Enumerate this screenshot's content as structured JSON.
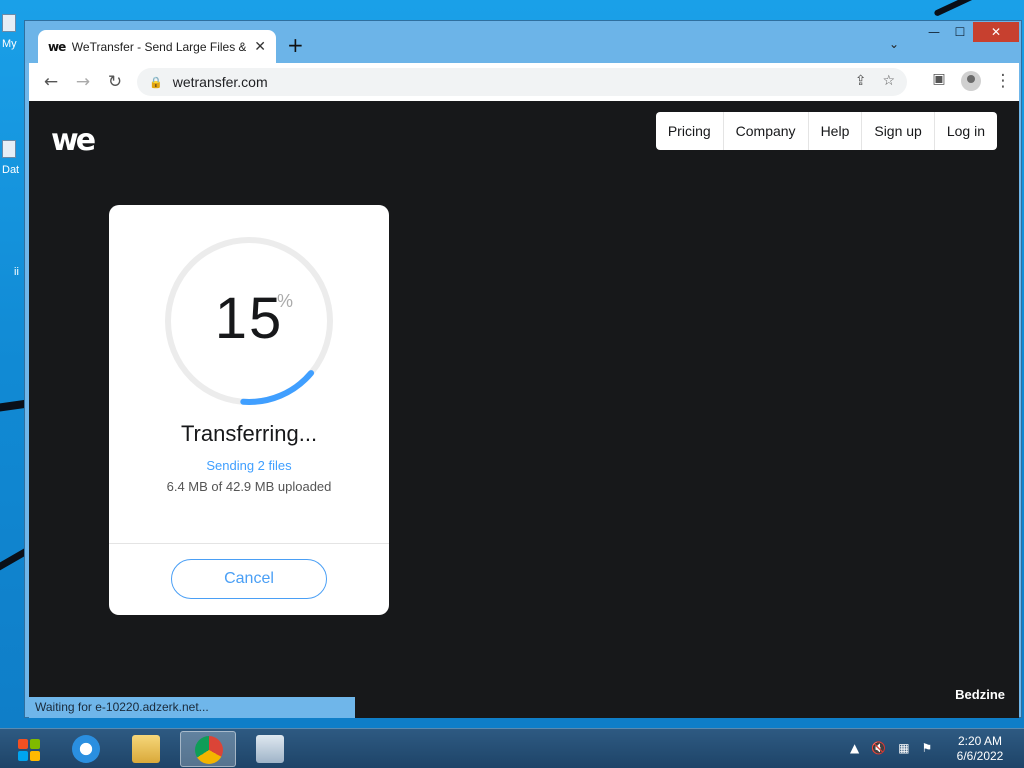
{
  "browser": {
    "tab_title": "WeTransfer - Send Large Files &",
    "tab_favicon": "we",
    "url": "wetransfer.com",
    "status_text": "Waiting for e-10220.adzerk.net...",
    "window_controls": {
      "minimize": "—",
      "maximize": "☐",
      "close": "✕"
    }
  },
  "desktop": {
    "icons": [
      {
        "label": "My"
      },
      {
        "label": "Dat"
      },
      {
        "label": "ii"
      }
    ]
  },
  "header": {
    "logo": "we",
    "nav": [
      "Pricing",
      "Company",
      "Help",
      "Sign up",
      "Log in"
    ]
  },
  "transfer": {
    "percent": "15",
    "percent_symbol": "%",
    "progress_fraction": 0.15,
    "title": "Transferring...",
    "subtitle": "Sending 2 files",
    "detail": "6.4 MB of 42.9 MB uploaded",
    "cancel_label": "Cancel"
  },
  "footer": {
    "credit": "Bedzine"
  },
  "taskbar": {
    "clock_time": "2:20 AM",
    "clock_date": "6/6/2022"
  },
  "colors": {
    "accent": "#409fff",
    "page_bg": "#17181a",
    "ring_track": "#ececec"
  }
}
